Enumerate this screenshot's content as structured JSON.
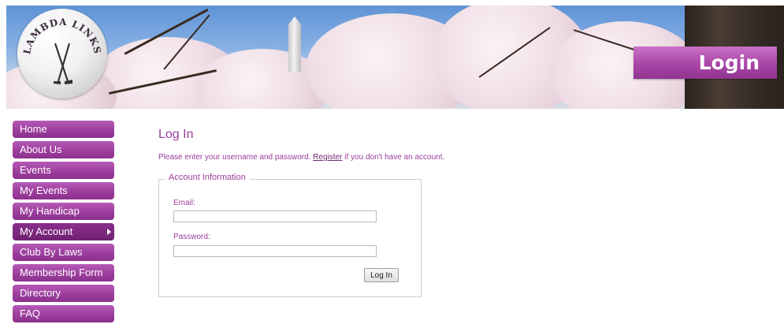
{
  "banner": {
    "logo_text": "LAMBDA LINKS",
    "page_label": "Login"
  },
  "sidebar": {
    "items": [
      {
        "label": "Home"
      },
      {
        "label": "About Us"
      },
      {
        "label": "Events"
      },
      {
        "label": "My Events"
      },
      {
        "label": "My Handicap"
      },
      {
        "label": "My Account"
      },
      {
        "label": "Club By Laws"
      },
      {
        "label": "Membership Form"
      },
      {
        "label": "Directory"
      },
      {
        "label": "FAQ"
      }
    ]
  },
  "main": {
    "title": "Log In",
    "intro_prefix": "Please enter your username and password.",
    "register_link": "Register",
    "intro_suffix": "if you don't have an account.",
    "fieldset_legend": "Account Information",
    "email_label": "Email:",
    "email_value": "",
    "password_label": "Password:",
    "password_value": "",
    "login_button": "Log In"
  },
  "colors": {
    "accent": "#9a3c9b",
    "nav_bg": "#9a3c9b",
    "nav_active_bg": "#7a267c"
  },
  "icons": {
    "submenu": "chevron-right-icon",
    "logo": "golf-ball-logo"
  }
}
